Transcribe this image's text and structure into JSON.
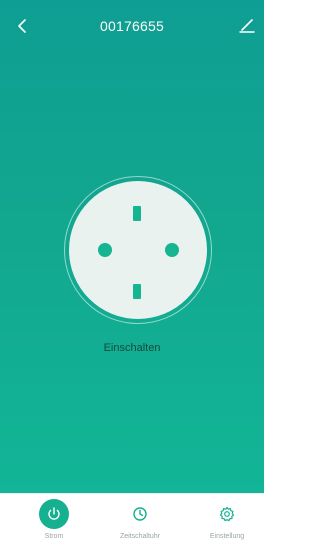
{
  "header": {
    "title": "00176655"
  },
  "device": {
    "status_label": "Einschalten"
  },
  "tabs": [
    {
      "label": "Strom",
      "icon": "power-icon",
      "active": true
    },
    {
      "label": "Zeitschaltuhr",
      "icon": "clock-icon",
      "active": false
    },
    {
      "label": "Einstellung",
      "icon": "gear-icon",
      "active": false
    }
  ],
  "colors": {
    "accent": "#14b08f",
    "gradient_top": "#0f9e93",
    "gradient_bottom": "#12b597",
    "socket_face": "#e9f2ef"
  }
}
